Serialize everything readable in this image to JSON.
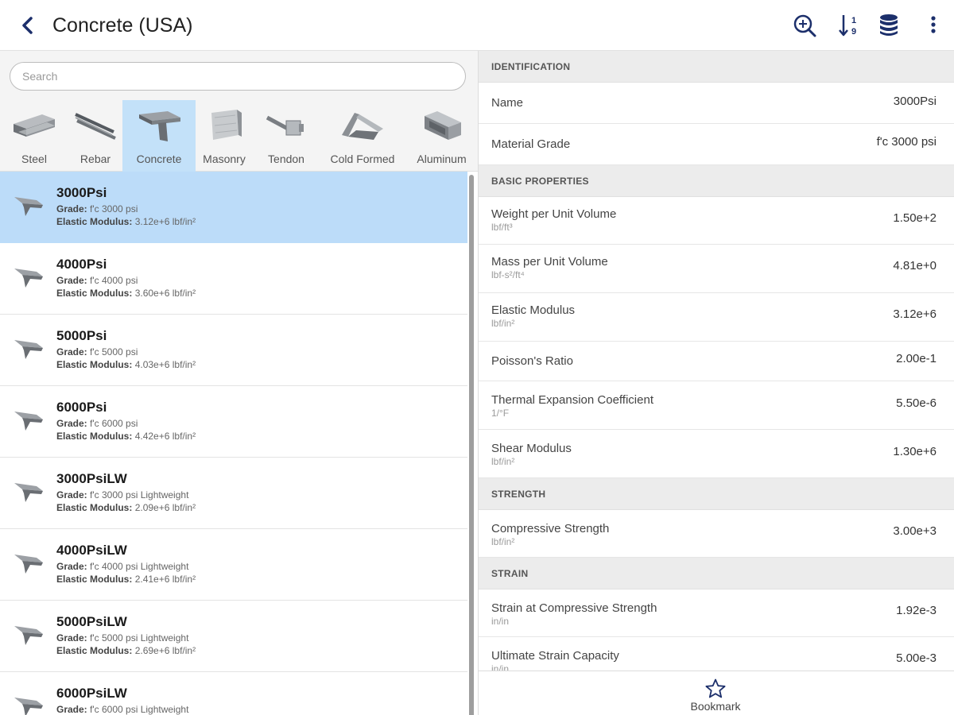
{
  "header": {
    "title": "Concrete (USA)",
    "icons": [
      "back-chevron-icon",
      "zoom-search-icon",
      "sort-numeric-icon",
      "database-icon",
      "more-vert-icon"
    ],
    "accent_color": "#1c2f6b"
  },
  "search": {
    "placeholder": "Search"
  },
  "categories": [
    {
      "label": "Steel",
      "active": false
    },
    {
      "label": "Rebar",
      "active": false
    },
    {
      "label": "Concrete",
      "active": true
    },
    {
      "label": "Masonry",
      "active": false
    },
    {
      "label": "Tendon",
      "active": false
    },
    {
      "label": "Cold Formed",
      "active": false
    },
    {
      "label": "Aluminum",
      "active": false
    }
  ],
  "materials": [
    {
      "name": "3000Psi",
      "grade_label": "Grade:",
      "grade": "f'c 3000 psi",
      "modulus_label": "Elastic Modulus:",
      "modulus": "3.12e+6 lbf/in²",
      "selected": true
    },
    {
      "name": "4000Psi",
      "grade_label": "Grade:",
      "grade": "f'c 4000 psi",
      "modulus_label": "Elastic Modulus:",
      "modulus": "3.60e+6 lbf/in²",
      "selected": false
    },
    {
      "name": "5000Psi",
      "grade_label": "Grade:",
      "grade": "f'c 5000 psi",
      "modulus_label": "Elastic Modulus:",
      "modulus": "4.03e+6 lbf/in²",
      "selected": false
    },
    {
      "name": "6000Psi",
      "grade_label": "Grade:",
      "grade": "f'c 6000 psi",
      "modulus_label": "Elastic Modulus:",
      "modulus": "4.42e+6 lbf/in²",
      "selected": false
    },
    {
      "name": "3000PsiLW",
      "grade_label": "Grade:",
      "grade": "f'c 3000 psi Lightweight",
      "modulus_label": "Elastic Modulus:",
      "modulus": "2.09e+6 lbf/in²",
      "selected": false
    },
    {
      "name": "4000PsiLW",
      "grade_label": "Grade:",
      "grade": "f'c 4000 psi Lightweight",
      "modulus_label": "Elastic Modulus:",
      "modulus": "2.41e+6 lbf/in²",
      "selected": false
    },
    {
      "name": "5000PsiLW",
      "grade_label": "Grade:",
      "grade": "f'c 5000 psi Lightweight",
      "modulus_label": "Elastic Modulus:",
      "modulus": "2.69e+6 lbf/in²",
      "selected": false
    },
    {
      "name": "6000PsiLW",
      "grade_label": "Grade:",
      "grade": "f'c 6000 psi Lightweight",
      "modulus_label": "Elastic Modulus:",
      "modulus": "",
      "selected": false
    }
  ],
  "details": {
    "identification": {
      "heading": "IDENTIFICATION",
      "name_label": "Name",
      "name_value": "3000Psi",
      "grade_label": "Material Grade",
      "grade_value": "f'c 3000 psi"
    },
    "basic": {
      "heading": "BASIC PROPERTIES",
      "weight_label": "Weight per Unit Volume",
      "weight_unit": "lbf/ft³",
      "weight_value": "1.50e+2",
      "mass_label": "Mass per Unit Volume",
      "mass_unit": "lbf-s²/ft⁴",
      "mass_value": "4.81e+0",
      "elastic_label": "Elastic Modulus",
      "elastic_unit": "lbf/in²",
      "elastic_value": "3.12e+6",
      "poisson_label": "Poisson's Ratio",
      "poisson_value": "2.00e-1",
      "thermal_label": "Thermal Expansion Coefficient",
      "thermal_unit": "1/°F",
      "thermal_value": "5.50e-6",
      "shear_label": "Shear Modulus",
      "shear_unit": "lbf/in²",
      "shear_value": "1.30e+6"
    },
    "strength": {
      "heading": "STRENGTH",
      "comp_label": "Compressive Strength",
      "comp_unit": "lbf/in²",
      "comp_value": "3.00e+3"
    },
    "strain": {
      "heading": "STRAIN",
      "scs_label": "Strain at Compressive Strength",
      "scs_unit": "in/in",
      "scs_value": "1.92e-3",
      "usc_label": "Ultimate Strain Capacity",
      "usc_unit": "in/in",
      "usc_value": "5.00e-3"
    }
  },
  "bottom": {
    "bookmark_label": "Bookmark"
  }
}
